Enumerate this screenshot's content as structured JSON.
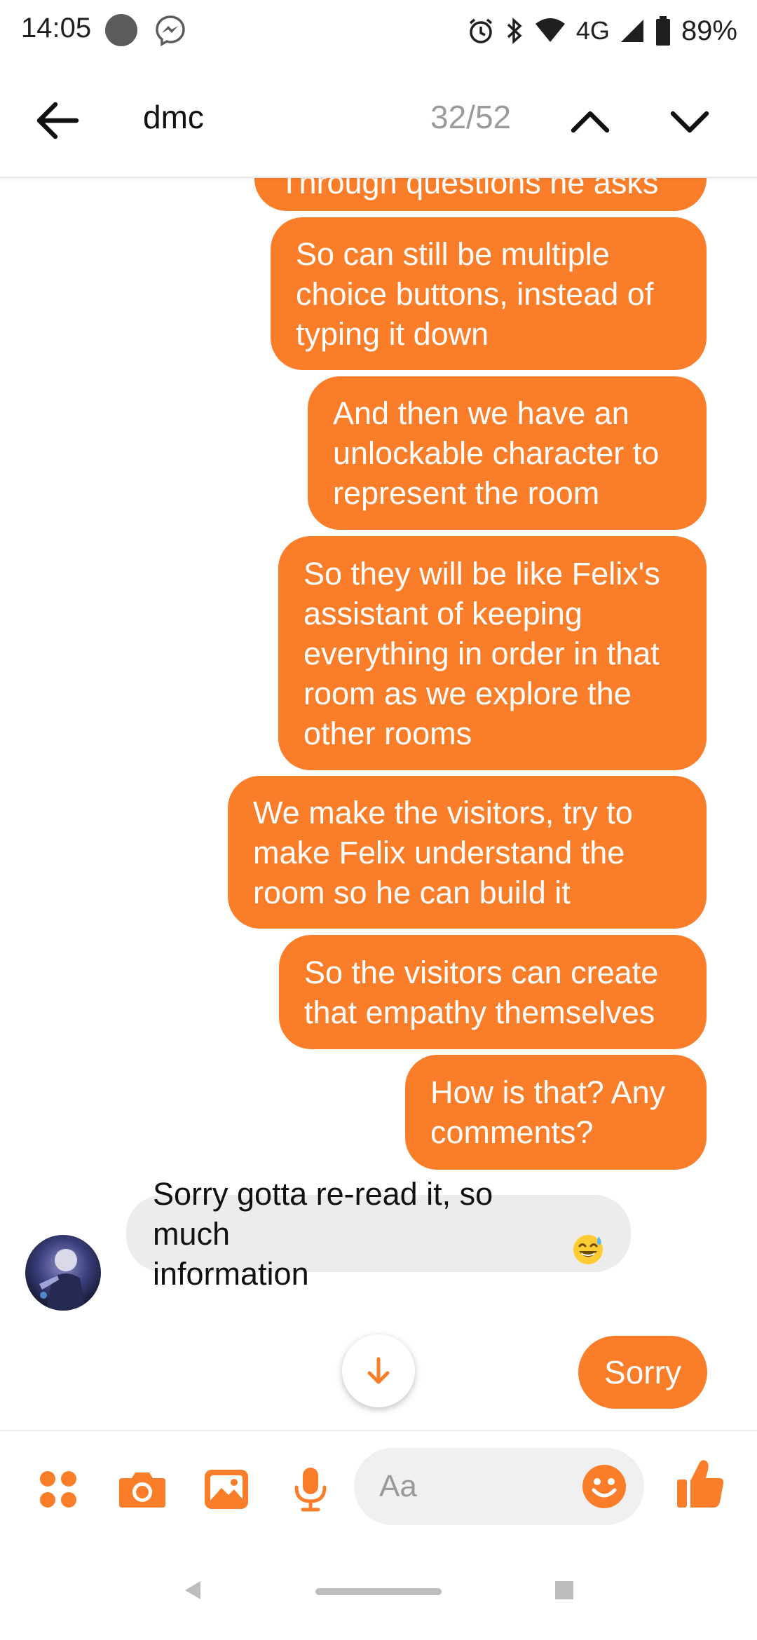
{
  "status_bar": {
    "time": "14:05",
    "network": "4G",
    "battery": "89%",
    "icons": [
      "notification-dot-icon",
      "messenger-icon",
      "alarm-icon",
      "bluetooth-icon",
      "wifi-icon",
      "cell-signal-icon",
      "battery-icon"
    ]
  },
  "header": {
    "search_term": "dmc",
    "match_count": "32/52",
    "icons": [
      "back-arrow-icon",
      "chevron-up-icon",
      "chevron-down-icon"
    ]
  },
  "messages": [
    {
      "sender": "me",
      "text": "Through questions he asks"
    },
    {
      "sender": "me",
      "text": "So can still be multiple\nchoice buttons, instead of\ntyping it down"
    },
    {
      "sender": "me",
      "text": "And then we have an\nunlockable character to\nrepresent the room"
    },
    {
      "sender": "me",
      "text": "So they will be like Felix's\nassistant of keeping\neverything in order in that\nroom as we explore the\nother rooms"
    },
    {
      "sender": "me",
      "text": "We make the visitors, try to\nmake Felix understand the\nroom so he can build it"
    },
    {
      "sender": "me",
      "text": "So the visitors can create\nthat empathy themselves"
    },
    {
      "sender": "me",
      "text": "How is that? Any\ncomments?"
    },
    {
      "sender": "them",
      "text": "Sorry gotta re-read it, so much\ninformation",
      "emoji": "grinning-sweat-emoji"
    }
  ],
  "quick_reply": "Sorry",
  "composer": {
    "placeholder": "Aa",
    "icons": [
      "menu-dots-icon",
      "camera-icon",
      "gallery-icon",
      "microphone-icon",
      "smiley-icon",
      "thumbs-up-icon"
    ]
  },
  "colors": {
    "accent": "#fa7e29",
    "incoming_bubble": "#ececec"
  }
}
